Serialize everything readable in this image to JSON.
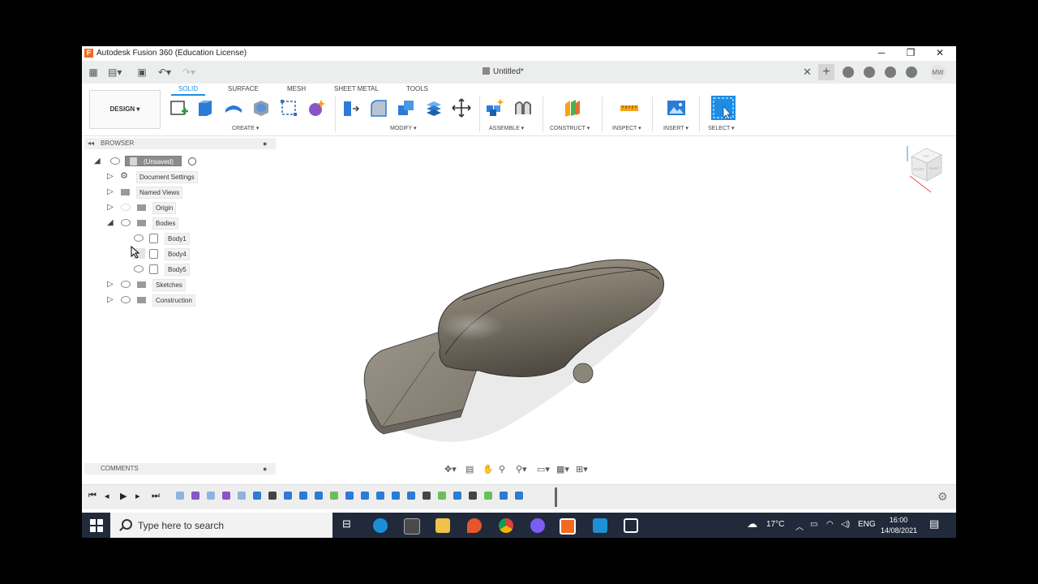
{
  "window": {
    "title": "Autodesk Fusion 360 (Education License)",
    "minimize": "─",
    "maximize": "❐",
    "close": "✕"
  },
  "quickbar": {
    "doc_title": "Untitled*",
    "avatar": "MW"
  },
  "ribbon": {
    "workspace": "DESIGN ▾",
    "tabs": [
      "SOLID",
      "SURFACE",
      "MESH",
      "SHEET METAL",
      "TOOLS"
    ],
    "groups": [
      "CREATE ▾",
      "MODIFY ▾",
      "ASSEMBLE ▾",
      "CONSTRUCT ▾",
      "INSPECT ▾",
      "INSERT ▾",
      "SELECT ▾"
    ]
  },
  "browser": {
    "title": "BROWSER",
    "root": "(Unsaved)",
    "items": [
      {
        "label": "Document Settings"
      },
      {
        "label": "Named Views"
      },
      {
        "label": "Origin"
      },
      {
        "label": "Bodies"
      },
      {
        "label": "Body1"
      },
      {
        "label": "Body4"
      },
      {
        "label": "Body5"
      },
      {
        "label": "Sketches"
      },
      {
        "label": "Construction"
      }
    ]
  },
  "comments": {
    "title": "COMMENTS"
  },
  "viewcube": {
    "faces": [
      "TOP",
      "FRONT",
      "RIGHT"
    ]
  },
  "taskbar": {
    "search_placeholder": "Type here to search",
    "weather": "17°C",
    "lang": "ENG",
    "time": "16:00",
    "date": "14/08/2021"
  },
  "colors": {
    "accent": "#1c8ce4",
    "taskbar": "#202a3a",
    "model": "#8a8276"
  }
}
